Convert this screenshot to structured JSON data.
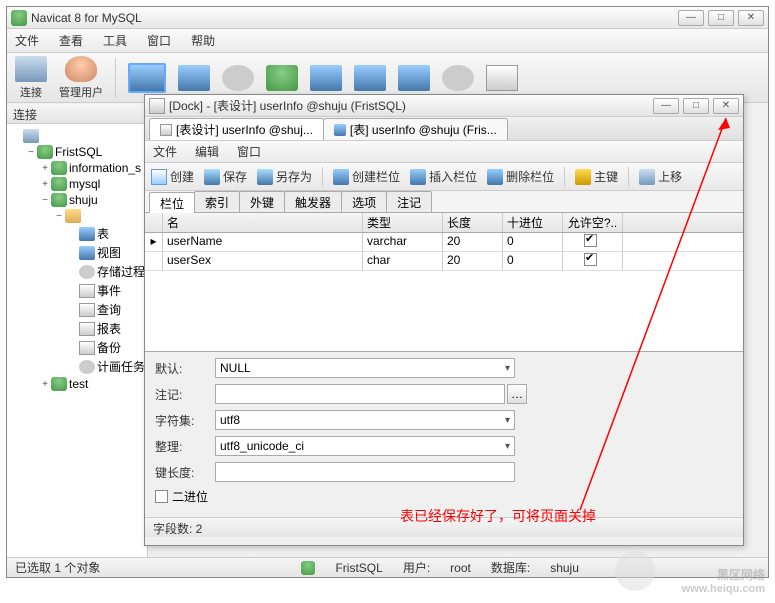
{
  "main_window": {
    "title": "Navicat 8 for MySQL",
    "menus": [
      "文件",
      "查看",
      "工具",
      "窗口",
      "帮助"
    ],
    "toolbar": [
      {
        "label": "连接",
        "icon": "connect-icon"
      },
      {
        "label": "管理用户",
        "icon": "user-icon"
      }
    ],
    "sidebar_title": "连接",
    "tree": [
      {
        "depth": 0,
        "toggle": "",
        "icon": "ic-conn",
        "label": ""
      },
      {
        "depth": 1,
        "toggle": "−",
        "icon": "ic-db",
        "label": "FristSQL"
      },
      {
        "depth": 2,
        "toggle": "+",
        "icon": "ic-db",
        "label": "information_s"
      },
      {
        "depth": 2,
        "toggle": "+",
        "icon": "ic-db",
        "label": "mysql"
      },
      {
        "depth": 2,
        "toggle": "−",
        "icon": "ic-db",
        "label": "shuju"
      },
      {
        "depth": 3,
        "toggle": "−",
        "icon": "ic-folder",
        "label": ""
      },
      {
        "depth": 4,
        "toggle": "",
        "icon": "ic-tbl",
        "label": "表"
      },
      {
        "depth": 4,
        "toggle": "",
        "icon": "ic-tbl",
        "label": "视图"
      },
      {
        "depth": 4,
        "toggle": "",
        "icon": "ic-gear",
        "label": "存储过程"
      },
      {
        "depth": 4,
        "toggle": "",
        "icon": "ic-doc",
        "label": "事件"
      },
      {
        "depth": 4,
        "toggle": "",
        "icon": "ic-doc",
        "label": "查询"
      },
      {
        "depth": 4,
        "toggle": "",
        "icon": "ic-doc",
        "label": "报表"
      },
      {
        "depth": 4,
        "toggle": "",
        "icon": "ic-doc",
        "label": "备份"
      },
      {
        "depth": 4,
        "toggle": "",
        "icon": "ic-gear",
        "label": "计画任务"
      },
      {
        "depth": 2,
        "toggle": "+",
        "icon": "ic-db",
        "label": "test"
      }
    ],
    "statusbar": {
      "selection": "已选取 1 个对象",
      "server": "FristSQL",
      "user_label": "用户:",
      "user": "root",
      "db_label": "数据库:",
      "db": "shuju"
    }
  },
  "designer": {
    "title": "[Dock] - [表设计] userInfo @shuju (FristSQL)",
    "doc_tabs": [
      {
        "label": "[表设计] userInfo @shuj...",
        "active": true
      },
      {
        "label": "[表] userInfo @shuju (Fris...",
        "active": false
      }
    ],
    "menus": [
      "文件",
      "编辑",
      "窗口"
    ],
    "toolbar": [
      {
        "icon": "ic-new",
        "label": "创建"
      },
      {
        "icon": "ic-save",
        "label": "保存"
      },
      {
        "icon": "ic-save",
        "label": "另存为"
      },
      {
        "icon": "ic-tbl",
        "label": "创建栏位"
      },
      {
        "icon": "ic-tbl",
        "label": "插入栏位"
      },
      {
        "icon": "ic-tbl",
        "label": "删除栏位"
      },
      {
        "icon": "ic-key",
        "label": "主键"
      },
      {
        "icon": "ic-conn",
        "label": "上移"
      }
    ],
    "field_tabs": [
      "栏位",
      "索引",
      "外键",
      "触发器",
      "选项",
      "注记"
    ],
    "grid": {
      "headers": [
        "名",
        "类型",
        "长度",
        "十进位",
        "允许空?.."
      ],
      "rows": [
        {
          "name": "userName",
          "type": "varchar",
          "len": "20",
          "dec": "0",
          "nullable": true,
          "current": true
        },
        {
          "name": "userSex",
          "type": "char",
          "len": "20",
          "dec": "0",
          "nullable": true,
          "current": false
        }
      ]
    },
    "props": {
      "default_label": "默认:",
      "default_value": "NULL",
      "note_label": "注记:",
      "note_value": "",
      "charset_label": "字符集:",
      "charset_value": "utf8",
      "collation_label": "整理:",
      "collation_value": "utf8_unicode_ci",
      "keylen_label": "键长度:",
      "keylen_value": "",
      "binary_label": "二进位"
    },
    "status": "字段数: 2"
  },
  "annotation": "表已经保存好了，可将页面关掉",
  "watermark": {
    "brand": "黑区网络",
    "url": "www.heiqu.com"
  }
}
